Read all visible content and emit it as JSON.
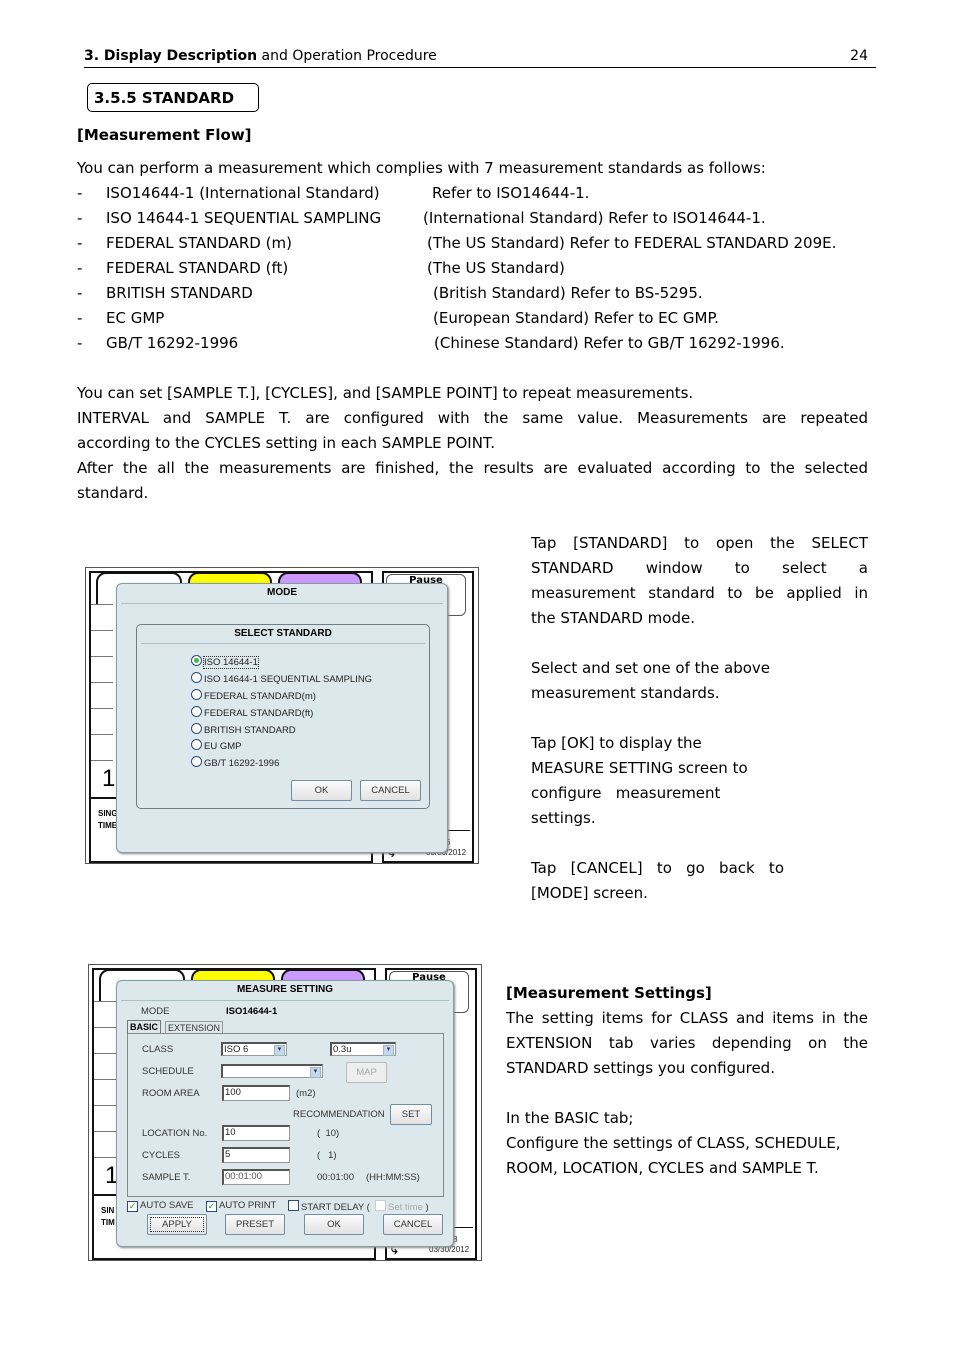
{
  "header": {
    "section_bold": "3. Display Description",
    "section_rest": " and Operation Procedure",
    "page_number": "24"
  },
  "section_box": "3.5.5 STANDARD",
  "measurement_flow": {
    "title": "[Measurement Flow]",
    "intro": "You can perform a measurement which complies with 7 measurement standards as follows:",
    "standards": [
      {
        "name": "ISO14644-1 (International Standard)",
        "desc": "Refer to ISO14644-1."
      },
      {
        "name": "ISO 14644-1 SEQUENTIAL SAMPLING",
        "desc": "(International Standard) Refer to ISO14644-1."
      },
      {
        "name": "FEDERAL STANDARD (m)",
        "desc": "(The US Standard) Refer to FEDERAL STANDARD 209E."
      },
      {
        "name": "FEDERAL STANDARD (ft)",
        "desc": "(The US Standard)"
      },
      {
        "name": "BRITISH STANDARD",
        "desc": "(British Standard) Refer to BS-5295."
      },
      {
        "name": "EC GMP",
        "desc": "(European Standard) Refer to EC GMP."
      },
      {
        "name": "GB/T 16292-1996",
        "desc": "(Chinese Standard) Refer to GB/T 16292-1996."
      }
    ],
    "bullet": "-",
    "para_lines": [
      "You can set [SAMPLE T.], [CYCLES], and [SAMPLE POINT] to repeat measurements.",
      "INTERVAL and SAMPLE T. are configured with the same value. Measurements are repeated",
      "according to the CYCLES setting in each SAMPLE POINT.",
      "After the all the measurements are finished, the results are evaluated according to the selected",
      "standard."
    ]
  },
  "screenshot1": {
    "background": {
      "pause_label": "Pause",
      "big_number": "1",
      "sing_label": "SING",
      "time_label": "TIME",
      "return_label": "RETURN",
      "corner_digit": "6",
      "date": "03/30/2012"
    },
    "mode_dialog": {
      "title": "MODE"
    },
    "select_standard": {
      "title": "SELECT STANDARD",
      "options": [
        {
          "label": "ISO 14644-1",
          "selected": true
        },
        {
          "label": "ISO 14644-1 SEQUENTIAL SAMPLING",
          "selected": false
        },
        {
          "label": "FEDERAL STANDARD(m)",
          "selected": false
        },
        {
          "label": "FEDERAL STANDARD(ft)",
          "selected": false
        },
        {
          "label": "BRITISH STANDARD",
          "selected": false
        },
        {
          "label": "EU GMP",
          "selected": false
        },
        {
          "label": "GB/T 16292-1996",
          "selected": false
        }
      ],
      "ok_label": "OK",
      "cancel_label": "CANCEL"
    }
  },
  "side_text1": {
    "para1": [
      "Tap [STANDARD] to open the SELECT",
      "STANDARD window to select a",
      "measurement standard to be applied in",
      "the STANDARD mode."
    ],
    "para2": [
      "Select and set one of the above",
      "measurement standards."
    ],
    "para3": [
      "Tap [OK] to display the",
      "MEASURE SETTING screen to",
      "configure   measurement",
      "settings."
    ],
    "para4": [
      "Tap [CANCEL] to go back to",
      "[MODE] screen."
    ]
  },
  "screenshot2": {
    "background": {
      "pause_label": "Pause",
      "big_number": "1",
      "sing_label": "SIN",
      "time_label": "TIM",
      "corner_digit": "8",
      "date": "03/30/2012"
    },
    "measure_setting": {
      "title": "MEASURE SETTING",
      "mode_label": "MODE",
      "mode_value": "ISO14644-1",
      "tabs": [
        {
          "label": "BASIC",
          "active": true
        },
        {
          "label": "EXTENSION",
          "active": false
        }
      ],
      "class_label": "CLASS",
      "class_value": "ISO 6",
      "particle_size_value": "0.3u",
      "schedule_label": "SCHEDULE",
      "schedule_value": "",
      "map_label": "MAP",
      "room_area_label": "ROOM AREA",
      "room_area_value": "100",
      "room_area_unit": "(m2)",
      "recommendation_label": "RECOMMENDATION",
      "set_label": "SET",
      "location_label": "LOCATION No.",
      "location_value": "10",
      "location_recommended": "(  10)",
      "cycles_label": "CYCLES",
      "cycles_value": "5",
      "cycles_recommended": "(   1)",
      "sample_t_label": "SAMPLE T.",
      "sample_t_value": "00:01:00",
      "sample_t_display": "00:01:00",
      "sample_t_format": "(HH:MM:SS)",
      "auto_save_label": "AUTO SAVE",
      "auto_save_checked": true,
      "auto_print_label": "AUTO PRINT",
      "auto_print_checked": true,
      "start_delay_label": "START DELAY (",
      "start_delay_checked": false,
      "set_time_label": "Set time",
      "set_time_close": ")",
      "apply_label": "APPLY",
      "preset_label": "PRESET",
      "ok_label": "OK",
      "cancel_label": "CANCEL"
    }
  },
  "side_text2": {
    "title": "[Measurement Settings]",
    "para1": [
      "The setting items for CLASS and items in the",
      "EXTENSION tab varies depending on the",
      "STANDARD settings you configured."
    ],
    "para2": [
      "In the BASIC tab;",
      "Configure the settings of CLASS, SCHEDULE,",
      "ROOM, LOCATION, CYCLES and SAMPLE T."
    ]
  }
}
